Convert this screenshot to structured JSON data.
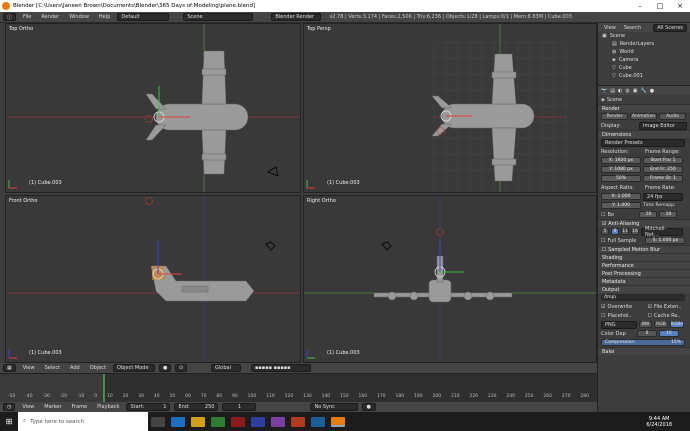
{
  "window": {
    "title": "Blender [C:\\Users\\Janeen Brown\\Documents\\Blender\\365 Days of Modeling\\plane.blend]"
  },
  "menu": {
    "file": "File",
    "render": "Render",
    "window": "Window",
    "help": "Help"
  },
  "layout": "Default",
  "scene": "Scene",
  "engine": "Blender Render",
  "stats": "v2.78 | Verts:3,174 | Faces:2,506 | Tris:6,236 | Objects:1/28 | Lamps:0/1 | Mem:8.83M | Cube.003",
  "viewports": [
    {
      "label": "Top Ortho",
      "object": "(1) Cube.003"
    },
    {
      "label": "Top Persp",
      "object": "(1) Cube.003"
    },
    {
      "label": "Front Ortho",
      "object": "(1) Cube.003"
    },
    {
      "label": "Right Ortho",
      "object": "(1) Cube.003"
    }
  ],
  "header3d": {
    "view": "View",
    "select": "Select",
    "add": "Add",
    "object": "Object",
    "mode": "Object Mode",
    "pivot": "Global"
  },
  "timeline": {
    "ticks": [
      "-50",
      "-40",
      "-30",
      "-20",
      "-10",
      "0",
      "10",
      "20",
      "30",
      "40",
      "50",
      "60",
      "70",
      "80",
      "90",
      "100",
      "110",
      "120",
      "130",
      "140",
      "150",
      "160",
      "170",
      "180",
      "190",
      "200",
      "210",
      "220",
      "230",
      "240",
      "250",
      "260",
      "270",
      "280"
    ],
    "view": "View",
    "marker": "Marker",
    "frame": "Frame",
    "playback": "Playback",
    "start": "Start:",
    "start_val": "1",
    "end": "End:",
    "end_val": "250",
    "current": "1",
    "sync": "No Sync"
  },
  "outliner": {
    "view": "View",
    "search": "Search",
    "scenes": "All Scenes",
    "items": [
      "Scene",
      "RenderLayers",
      "World",
      "Camera",
      "Cube",
      "Cube.001"
    ]
  },
  "properties": {
    "scene": "Scene",
    "render": "Render",
    "render_btn": "Render",
    "animation_btn": "Animation",
    "audio_btn": "Audio",
    "display_label": "Display:",
    "display_val": "Image Editor",
    "dimensions": "Dimensions",
    "presets": "Render Presets",
    "resolution": "Resolution:",
    "res_x": "X: 1920 px",
    "res_y": "Y: 1080 px",
    "res_pct": "50%",
    "frame_range": "Frame Range:",
    "start_frame": "Start Fra: 1",
    "end_frame": "End Fr: 250",
    "frame_step": "Frame St: 1",
    "aspect": "Aspect Ratio:",
    "asp_x": "X: 1.000",
    "asp_y": "Y: 1.000",
    "frame_rate": "Frame Rate:",
    "fps": "24 fps",
    "time_remap": "Time Remapp:",
    "remap_old": "10",
    "remap_new": "10",
    "bo": "Bo",
    "aa": "Anti-Aliasing",
    "aa_5": "5",
    "aa_8": "8",
    "aa_11": "11",
    "aa_16": "16",
    "aa_filter": "Mitchell-Net...",
    "full_sample": "Full Sample",
    "aa_size": "S: 1.000 px",
    "motion_blur": "Sampled Motion Blur",
    "shading": "Shading",
    "performance": "Performance",
    "post": "Post Processing",
    "metadata": "Metadata",
    "output": "Output",
    "output_path": "/tmp\\",
    "overwrite": "Overwrite",
    "file_ext": "File Exten..",
    "placeholders": "Placehol..",
    "cache": "Cache Re..",
    "format": "PNG",
    "bw": "BW",
    "rgb": "RGB",
    "rgba": "RGBA",
    "color_depth": "Color Dep",
    "depth8": "8",
    "depth16": "16",
    "compression": "Compression:",
    "compression_val": "15%",
    "bake": "Bake"
  },
  "taskbar": {
    "search": "Type here to search",
    "time": "9:44 AM",
    "date": "6/24/2018"
  }
}
